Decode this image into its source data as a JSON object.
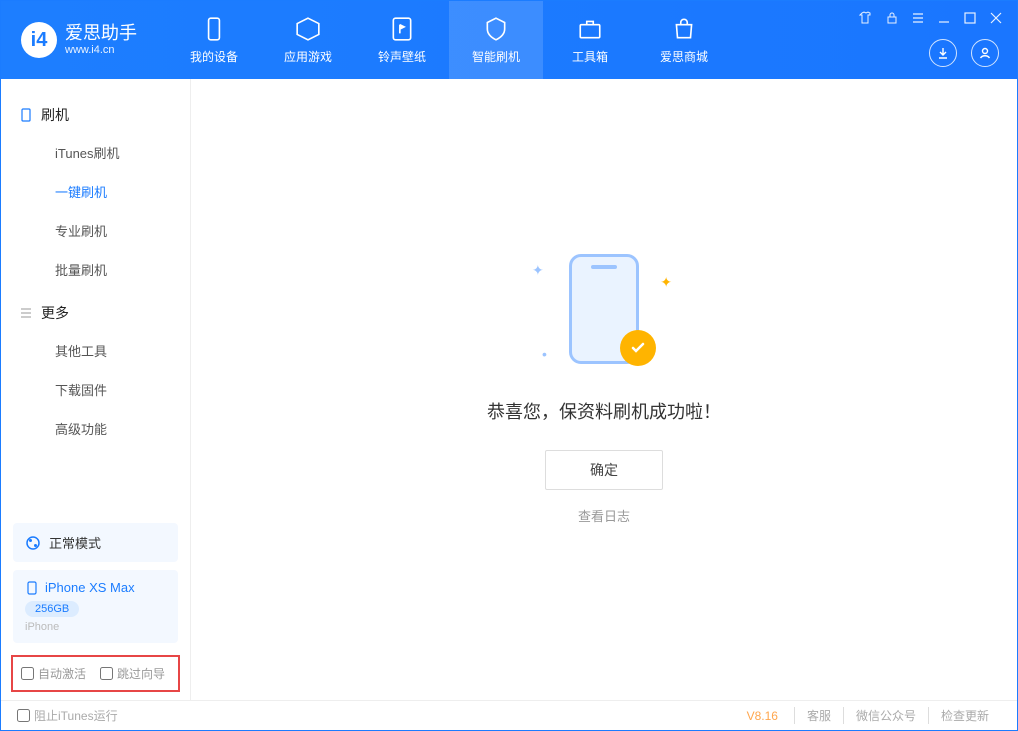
{
  "app": {
    "name": "爱思助手",
    "domain": "www.i4.cn"
  },
  "nav": {
    "items": [
      {
        "label": "我的设备"
      },
      {
        "label": "应用游戏"
      },
      {
        "label": "铃声壁纸"
      },
      {
        "label": "智能刷机"
      },
      {
        "label": "工具箱"
      },
      {
        "label": "爱思商城"
      }
    ]
  },
  "sidebar": {
    "group1_title": "刷机",
    "group1": [
      {
        "label": "iTunes刷机"
      },
      {
        "label": "一键刷机"
      },
      {
        "label": "专业刷机"
      },
      {
        "label": "批量刷机"
      }
    ],
    "group2_title": "更多",
    "group2": [
      {
        "label": "其他工具"
      },
      {
        "label": "下载固件"
      },
      {
        "label": "高级功能"
      }
    ],
    "status": "正常模式",
    "device": {
      "name": "iPhone XS Max",
      "storage": "256GB",
      "type": "iPhone"
    },
    "checks": {
      "auto_activate": "自动激活",
      "skip_guide": "跳过向导"
    }
  },
  "main": {
    "success_text": "恭喜您，保资料刷机成功啦！",
    "ok_btn": "确定",
    "log_link": "查看日志"
  },
  "footer": {
    "block_itunes": "阻止iTunes运行",
    "version": "V8.16",
    "links": [
      "客服",
      "微信公众号",
      "检查更新"
    ]
  }
}
